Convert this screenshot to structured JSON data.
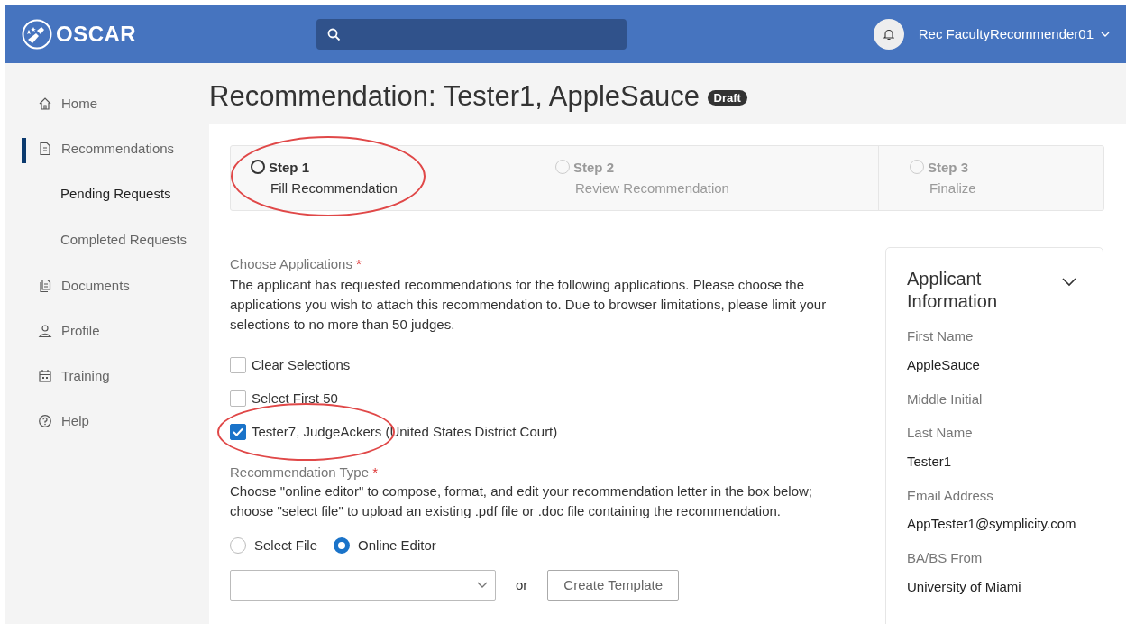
{
  "header": {
    "logo": "OSCAR",
    "user": "Rec FacultyRecommender01"
  },
  "sidebar": {
    "items": [
      {
        "label": "Home",
        "selected": false
      },
      {
        "label": "Recommendations",
        "selected": true,
        "children": [
          {
            "label": "Pending Requests",
            "selected": true
          },
          {
            "label": "Completed Requests",
            "selected": false
          }
        ]
      },
      {
        "label": "Documents",
        "selected": false
      },
      {
        "label": "Profile",
        "selected": false
      },
      {
        "label": "Training",
        "selected": false
      },
      {
        "label": "Help",
        "selected": false
      }
    ]
  },
  "page": {
    "title": "Recommendation: Tester1, AppleSauce",
    "badge": "Draft"
  },
  "steps": [
    {
      "label": "Step 1",
      "caption": "Fill Recommendation",
      "selected": true,
      "circled": true
    },
    {
      "label": "Step 2",
      "caption": "Review Recommendation",
      "selected": false,
      "circled": false
    },
    {
      "label": "Step 3",
      "caption": "Finalize",
      "selected": false,
      "circled": false
    }
  ],
  "applications": {
    "label": "Choose Applications",
    "required": "*",
    "help": "The applicant has requested recommendations for the following applications. Please choose the applications you wish to attach this recommendation to. Due to browser limitations, please limit your selections to no more than 50 judges.",
    "options": [
      {
        "label": "Clear Selections",
        "checked": false,
        "circled": false
      },
      {
        "label": "Select First 50",
        "checked": false,
        "circled": false
      },
      {
        "label": "Tester7, JudgeAckers (United States District Court)",
        "checked": true,
        "circled": true
      }
    ]
  },
  "recommendation_type": {
    "label": "Recommendation Type",
    "required": "*",
    "help": "Choose \"online editor\" to compose, format, and edit your recommendation letter in the box below; choose \"select file\" to upload an existing .pdf file or .doc file containing the recommendation.",
    "options": [
      {
        "label": "Select File",
        "selected": false
      },
      {
        "label": "Online Editor",
        "selected": true
      }
    ],
    "or": "or",
    "button": "Create Template"
  },
  "applicant_info": {
    "title": "Applicant Information",
    "expanded": true,
    "fields": [
      {
        "label": "First Name",
        "value": "AppleSauce"
      },
      {
        "label": "Middle Initial"
      },
      {
        "label": "Last Name",
        "value": "Tester1"
      },
      {
        "label": "Email Address",
        "value": "AppTester1@symplicity.com"
      },
      {
        "label": "BA/BS From",
        "value": "University of Miami"
      }
    ]
  }
}
